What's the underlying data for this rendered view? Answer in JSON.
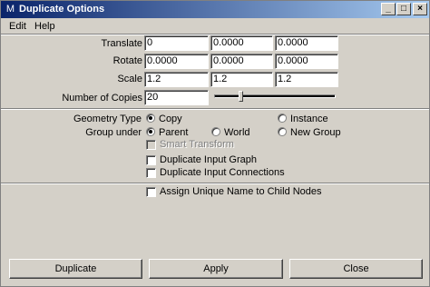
{
  "window": {
    "title": "Duplicate Options",
    "title_icon": "maya-icon",
    "controls": {
      "minimize": "_",
      "maximize": "□",
      "close": "×"
    }
  },
  "menu": [
    "Edit",
    "Help"
  ],
  "transform": {
    "translate": {
      "label": "Translate",
      "values": [
        "0",
        "0.0000",
        "0.0000"
      ]
    },
    "rotate": {
      "label": "Rotate",
      "values": [
        "0.0000",
        "0.0000",
        "0.0000"
      ]
    },
    "scale": {
      "label": "Scale",
      "values": [
        "1.2",
        "1.2",
        "1.2"
      ]
    }
  },
  "copies": {
    "label": "Number of Copies",
    "value": "20",
    "slider_fraction": 0.22
  },
  "geometry_type": {
    "label": "Geometry Type",
    "options": [
      {
        "label": "Copy",
        "selected": true
      },
      {
        "label": "Instance",
        "selected": false
      }
    ]
  },
  "group_under": {
    "label": "Group under",
    "options": [
      {
        "label": "Parent",
        "selected": true
      },
      {
        "label": "World",
        "selected": false
      },
      {
        "label": "New Group",
        "selected": false
      }
    ]
  },
  "smart_transform": {
    "label": "Smart Transform",
    "checked": false,
    "enabled": false
  },
  "duplicate_input_graph": {
    "label": "Duplicate Input Graph",
    "checked": false
  },
  "duplicate_input_connections": {
    "label": "Duplicate Input Connections",
    "checked": false
  },
  "assign_unique_name": {
    "label": "Assign Unique Name to Child Nodes",
    "checked": false
  },
  "buttons": {
    "duplicate": "Duplicate",
    "apply": "Apply",
    "close": "Close"
  }
}
